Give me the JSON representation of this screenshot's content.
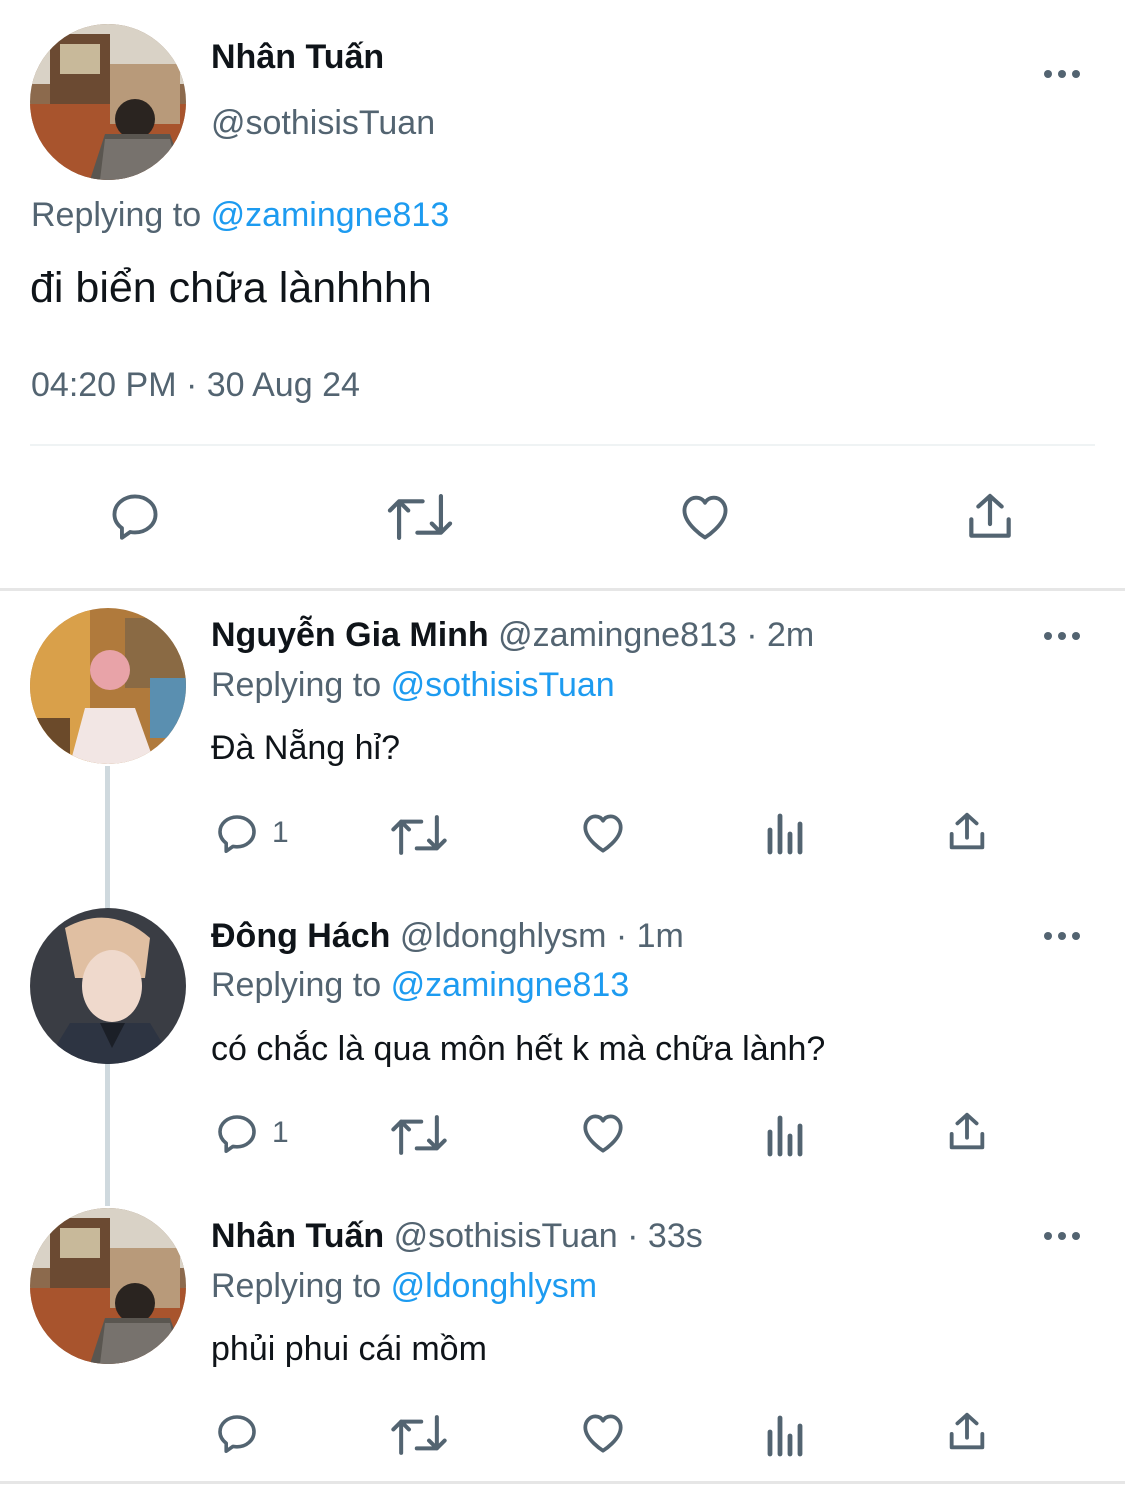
{
  "main_tweet": {
    "author_name": "Nhân Tuấn",
    "handle": "@sothisisTuan",
    "replying_label": "Replying to",
    "replying_to": "@zamingne813",
    "text": "đi biển chữa lànhhhh",
    "timestamp": "04:20 PM · 30 Aug 24"
  },
  "replies": [
    {
      "author_name": "Nguyễn Gia Minh",
      "meta": "@zamingne813 · 2m",
      "replying_label": "Replying to",
      "replying_to": "@sothisisTuan",
      "text": "Đà Nẵng hỉ?",
      "reply_count": "1"
    },
    {
      "author_name": "Đông Hách",
      "meta": "@ldonghlysm · 1m",
      "replying_label": "Replying to",
      "replying_to": "@zamingne813",
      "text": "có chắc là qua môn hết k mà chữa lành?",
      "reply_count": "1"
    },
    {
      "author_name": "Nhân Tuấn",
      "meta": "@sothisisTuan · 33s",
      "replying_label": "Replying to",
      "replying_to": "@ldonghlysm",
      "text": "phủi phui cái mồm",
      "reply_count": ""
    }
  ],
  "icons": {
    "reply": "reply-icon",
    "retweet": "retweet-icon",
    "like": "like-icon",
    "analytics": "analytics-icon",
    "share": "share-icon",
    "more": "more-icon"
  },
  "colors": {
    "text": "#0f1419",
    "secondary": "#536471",
    "link": "#1d9bf0",
    "divider": "#e6e6e6"
  }
}
